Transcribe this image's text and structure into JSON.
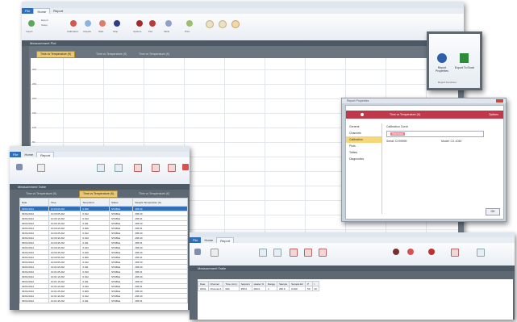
{
  "main_window": {
    "title": "",
    "tabs": [
      "File",
      "Home",
      "Report"
    ],
    "panel_title": "Measurement Plot",
    "doc_tabs": [
      "Time vs Temperature (K)",
      "Time vs Temperature (K)",
      "Time vs Temperature (K)"
    ],
    "ribbon_labels": [
      "Import",
      "Export",
      "Setup",
      "Calibration",
      "Acquire",
      "Start",
      "Stop",
      "Options",
      "Plot",
      "Table",
      "Print"
    ],
    "y_ticks": [
      "300",
      "250",
      "200",
      "150",
      "100",
      "50",
      "0",
      "-50",
      "-100",
      "-150",
      "-200",
      "-250"
    ]
  },
  "report_popup": {
    "labels": [
      "Report Properties",
      "Export To Excel"
    ],
    "group_label": "Report Functions"
  },
  "data_window": {
    "tabs": [
      "File",
      "Home",
      "Report"
    ],
    "panel_title": "Measurement Table",
    "doc_tabs": [
      "Time vs Temperature (K)",
      "Time vs Temperature (K)",
      "Time vs Temperature (K)"
    ],
    "columns": [
      "Date",
      "Time",
      "Temp Error",
      "Status",
      "Sample Temperature (K)"
    ],
    "rows": [
      [
        "03/01/2012",
        "10:00:00 AM",
        "0.000",
        "STABLE",
        "295.00"
      ],
      [
        "03/01/2012",
        "10:00:05 AM",
        "0.012",
        "STABLE",
        "295.00"
      ],
      [
        "03/01/2012",
        "10:00:10 AM",
        "0.010",
        "STABLE",
        "295.01"
      ],
      [
        "03/01/2012",
        "10:00:15 AM",
        "0.011",
        "STABLE",
        "295.00"
      ],
      [
        "03/01/2012",
        "10:00:20 AM",
        "0.009",
        "STABLE",
        "295.01"
      ],
      [
        "03/01/2012",
        "10:00:25 AM",
        "0.012",
        "STABLE",
        "295.00"
      ],
      [
        "03/01/2012",
        "10:00:30 AM",
        "0.010",
        "STABLE",
        "295.00"
      ],
      [
        "03/01/2012",
        "10:00:35 AM",
        "0.011",
        "STABLE",
        "295.01"
      ],
      [
        "03/01/2012",
        "10:00:40 AM",
        "0.013",
        "STABLE",
        "295.00"
      ],
      [
        "03/01/2012",
        "10:00:45 AM",
        "0.010",
        "STABLE",
        "295.00"
      ],
      [
        "03/01/2012",
        "10:00:50 AM",
        "0.009",
        "STABLE",
        "295.01"
      ],
      [
        "03/01/2012",
        "10:00:55 AM",
        "0.012",
        "STABLE",
        "295.00"
      ],
      [
        "03/01/2012",
        "10:01:00 AM",
        "0.011",
        "STABLE",
        "295.00"
      ],
      [
        "03/01/2012",
        "10:01:05 AM",
        "0.010",
        "STABLE",
        "295.01"
      ],
      [
        "03/01/2012",
        "10:01:10 AM",
        "0.012",
        "STABLE",
        "295.00"
      ],
      [
        "03/01/2012",
        "10:01:15 AM",
        "0.011",
        "STABLE",
        "295.00"
      ],
      [
        "03/01/2012",
        "10:01:20 AM",
        "0.010",
        "STABLE",
        "295.01"
      ],
      [
        "03/01/2012",
        "10:01:25 AM",
        "0.009",
        "STABLE",
        "295.00"
      ],
      [
        "03/01/2012",
        "10:01:30 AM",
        "0.012",
        "STABLE",
        "295.00"
      ],
      [
        "03/01/2012",
        "10:01:35 AM",
        "0.011",
        "STABLE",
        "295.01"
      ]
    ]
  },
  "dialog": {
    "title": "Report Properties",
    "header": "Time vs Temperature (K)",
    "header_right": "Options",
    "nav": [
      "General",
      "Channels",
      "Calibration",
      "Plots",
      "Tables",
      "Diagnostics"
    ],
    "nav_selected": 2,
    "section_label": "Calibration Curve",
    "combo_value": "Standard",
    "field1_label": "Serial:  CX99999",
    "field2_label": "Model:  CX-1030",
    "ok_label": "OK"
  },
  "bottom_window": {
    "tabs": [
      "File",
      "Home",
      "Report"
    ],
    "panel_title": "Measurement Table",
    "columns": [
      "Date",
      "Channel",
      "Time (min)",
      "Setpoint",
      "Heater %",
      "Range",
      "Sample",
      "Sample Err",
      "P",
      "I"
    ],
    "row": [
      "03/01",
      "Channel A",
      "000",
      "295.0",
      "000.0",
      "1",
      "295.0",
      "0.000",
      "50",
      "20"
    ]
  },
  "colors": {
    "accent": "#2f6eb8",
    "panel_header": "#4d5a66",
    "dialog_header": "#c0394b",
    "selection": "#f5d77a",
    "connector": "#d04a5a"
  }
}
